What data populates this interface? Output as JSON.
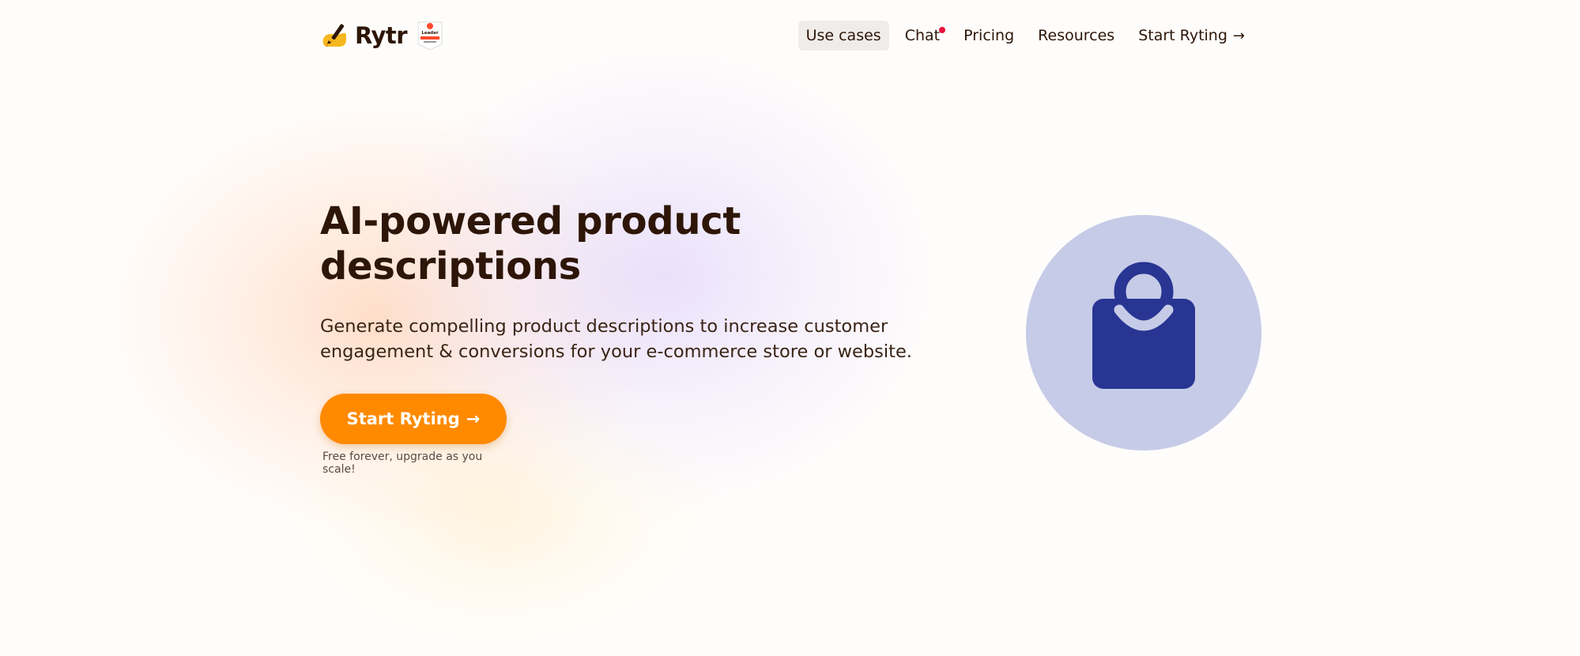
{
  "brand": {
    "name": "Rytr",
    "badge_icon": "g2-leader-badge",
    "badge_text": "Leader"
  },
  "nav": {
    "items": [
      {
        "label": "Use cases",
        "active": true
      },
      {
        "label": "Chat",
        "has_notification": true
      },
      {
        "label": "Pricing"
      },
      {
        "label": "Resources"
      },
      {
        "label": "Start Ryting",
        "icon": "arrow-right-icon"
      }
    ],
    "arrow": "→"
  },
  "hero": {
    "title": "AI-powered product descriptions",
    "subtitle": "Generate compelling product descriptions to increase customer engagement & conversions for your e-commerce store or website.",
    "cta_label": "Start Ryting",
    "cta_arrow": "→",
    "cta_note": "Free forever, upgrade as you scale!"
  },
  "illustration": {
    "icon": "shopping-bag-icon",
    "circle_color": "#c6cbe7",
    "icon_color": "#283593"
  },
  "colors": {
    "accent": "#ff8a00",
    "text": "#2d1608",
    "notification": "#e8123c"
  }
}
